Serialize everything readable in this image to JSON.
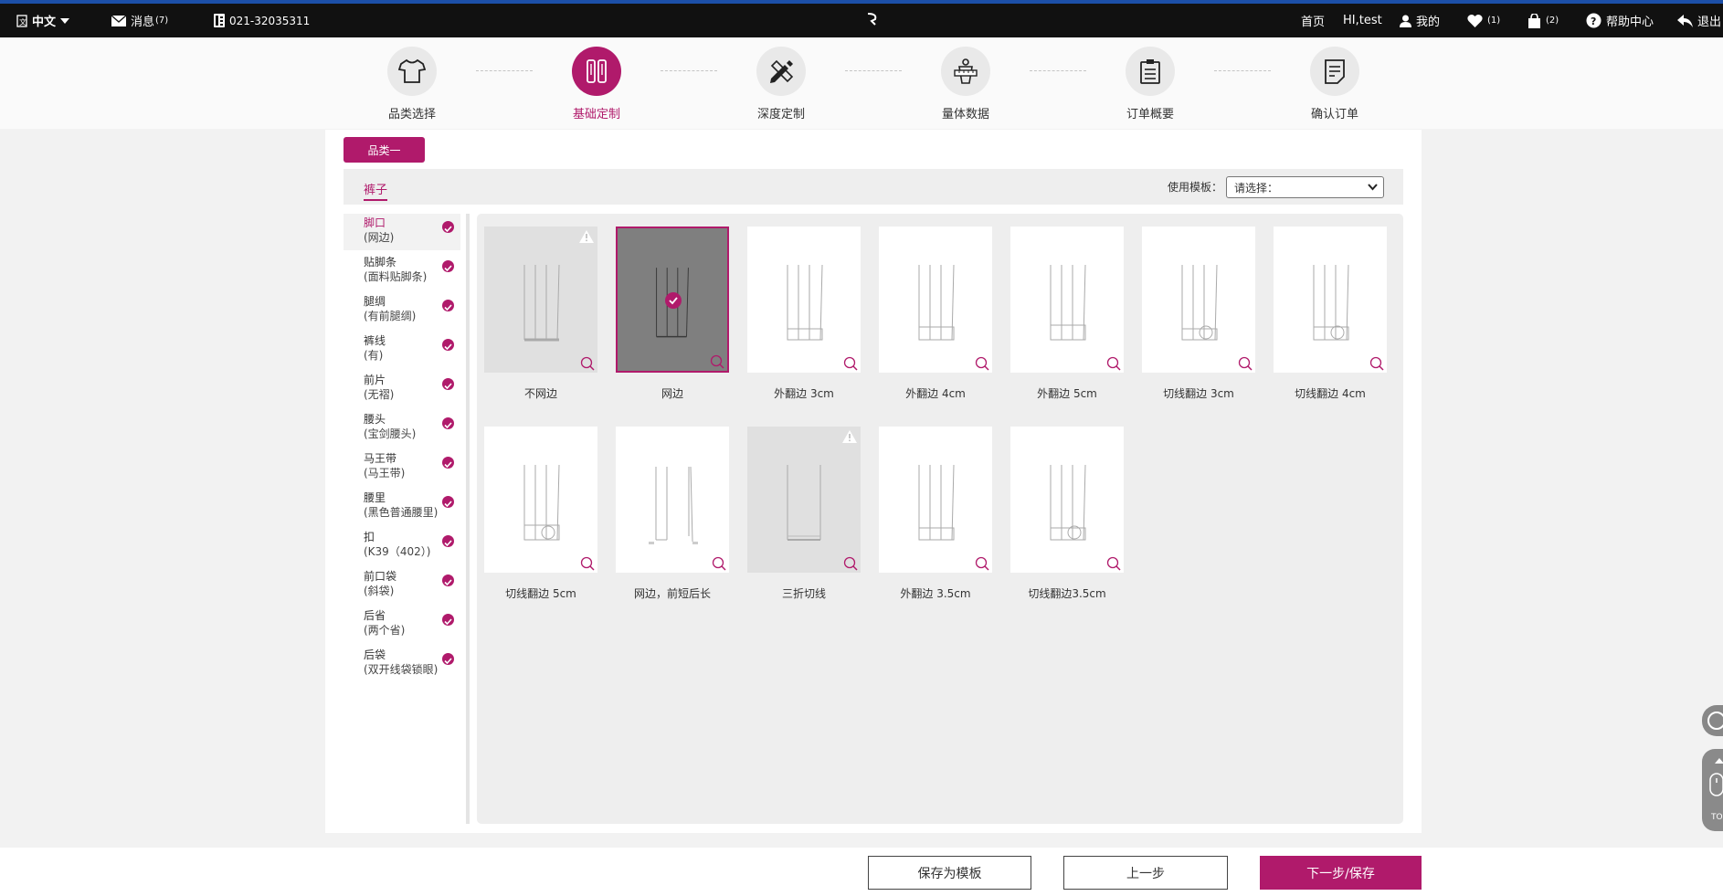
{
  "topbar": {
    "language": "中文",
    "messages_label": "消息",
    "messages_count": "(7)",
    "phone": "021-32035311",
    "home": "首页",
    "user": "HI,test",
    "mine": "我的",
    "favorites_count": "(1)",
    "cart_count": "(2)",
    "help": "帮助中心",
    "logout": "退出"
  },
  "steps": [
    {
      "label": "品类选择",
      "icon": "shirt-icon"
    },
    {
      "label": "基础定制",
      "icon": "fabric-icon",
      "active": true
    },
    {
      "label": "深度定制",
      "icon": "pencil-ruler-icon"
    },
    {
      "label": "量体数据",
      "icon": "measure-icon"
    },
    {
      "label": "订单概要",
      "icon": "clipboard-icon"
    },
    {
      "label": "确认订单",
      "icon": "document-check-icon"
    }
  ],
  "category_button": "品类一",
  "tab": "裤子",
  "template": {
    "label": "使用模板：",
    "selected": "请选择："
  },
  "sidebar": [
    {
      "title": "脚口",
      "value": "(网边)"
    },
    {
      "title": "贴脚条",
      "value": "(面料贴脚条)"
    },
    {
      "title": "腿绸",
      "value": "(有前腿绸)"
    },
    {
      "title": "裤线",
      "value": "(有)"
    },
    {
      "title": "前片",
      "value": "(无褶)"
    },
    {
      "title": "腰头",
      "value": "(宝剑腰头)"
    },
    {
      "title": "马王带",
      "value": "(马王带)"
    },
    {
      "title": "腰里",
      "value": "(黑色普通腰里)"
    },
    {
      "title": "扣",
      "value": "(K39（402）)"
    },
    {
      "title": "前口袋",
      "value": "(斜袋)"
    },
    {
      "title": "后省",
      "value": "(两个省)"
    },
    {
      "title": "后袋",
      "value": "(双开线袋锁眼)"
    }
  ],
  "options": [
    {
      "label": "不网边",
      "state": "disabled"
    },
    {
      "label": "网边",
      "state": "selected"
    },
    {
      "label": "外翻边 3cm",
      "state": "normal"
    },
    {
      "label": "外翻边 4cm",
      "state": "normal"
    },
    {
      "label": "外翻边 5cm",
      "state": "normal"
    },
    {
      "label": "切线翻边 3cm",
      "state": "normal"
    },
    {
      "label": "切线翻边 4cm",
      "state": "normal"
    },
    {
      "label": "切线翻边 5cm",
      "state": "normal"
    },
    {
      "label": "网边，前短后长",
      "state": "normal"
    },
    {
      "label": "三折切线",
      "state": "disabled"
    },
    {
      "label": "外翻边 3.5cm",
      "state": "normal"
    },
    {
      "label": "切线翻边3.5cm",
      "state": "normal"
    }
  ],
  "buttons": {
    "save_template": "保存为模板",
    "prev": "上一步",
    "next": "下一步/保存"
  },
  "float_tool": {
    "top_label": "TO"
  },
  "colors": {
    "accent": "#b01a6b",
    "topbar": "#111111"
  }
}
